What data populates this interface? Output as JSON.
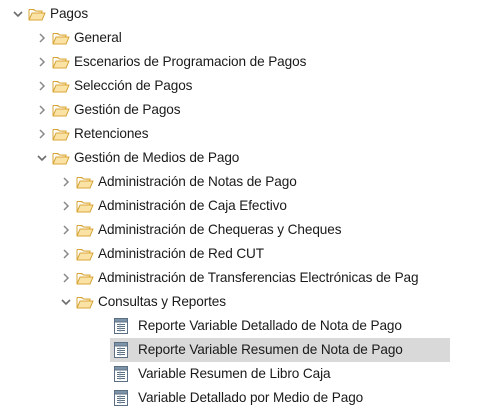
{
  "tree": {
    "root": {
      "label": "Pagos",
      "expanded": true
    },
    "level1": [
      {
        "label": "General",
        "expanded": false
      },
      {
        "label": "Escenarios de Programacion de Pagos",
        "expanded": false
      },
      {
        "label": "Selección de Pagos",
        "expanded": false
      },
      {
        "label": "Gestión de Pagos",
        "expanded": false
      },
      {
        "label": "Retenciones",
        "expanded": false
      },
      {
        "label": "Gestión de Medios de Pago",
        "expanded": true
      }
    ],
    "level2": [
      {
        "label": "Administración de Notas de Pago",
        "expanded": false
      },
      {
        "label": "Administración de Caja Efectivo",
        "expanded": false
      },
      {
        "label": "Administración de Chequeras y Cheques",
        "expanded": false
      },
      {
        "label": "Administración de Red CUT",
        "expanded": false
      },
      {
        "label": "Administración de Transferencias Electrónicas de Pag",
        "expanded": false
      },
      {
        "label": "Consultas y Reportes",
        "expanded": true
      }
    ],
    "level3": [
      {
        "label": "Reporte Variable Detallado de Nota de Pago",
        "selected": false
      },
      {
        "label": "Reporte Variable Resumen de Nota de Pago",
        "selected": true
      },
      {
        "label": "Variable Resumen de Libro Caja",
        "selected": false
      },
      {
        "label": "Variable Detallado por Medio de Pago",
        "selected": false
      }
    ]
  },
  "colors": {
    "folder_fill": "#fbe3a6",
    "folder_stroke": "#d8a437",
    "selection": "#d9d9d9",
    "chevron": "#6b6b6b",
    "doc_stroke": "#5a6f84"
  },
  "icons": {
    "expanded": "chevron-down-icon",
    "collapsed": "chevron-right-icon",
    "folder": "open-folder-icon",
    "report": "report-document-icon"
  }
}
